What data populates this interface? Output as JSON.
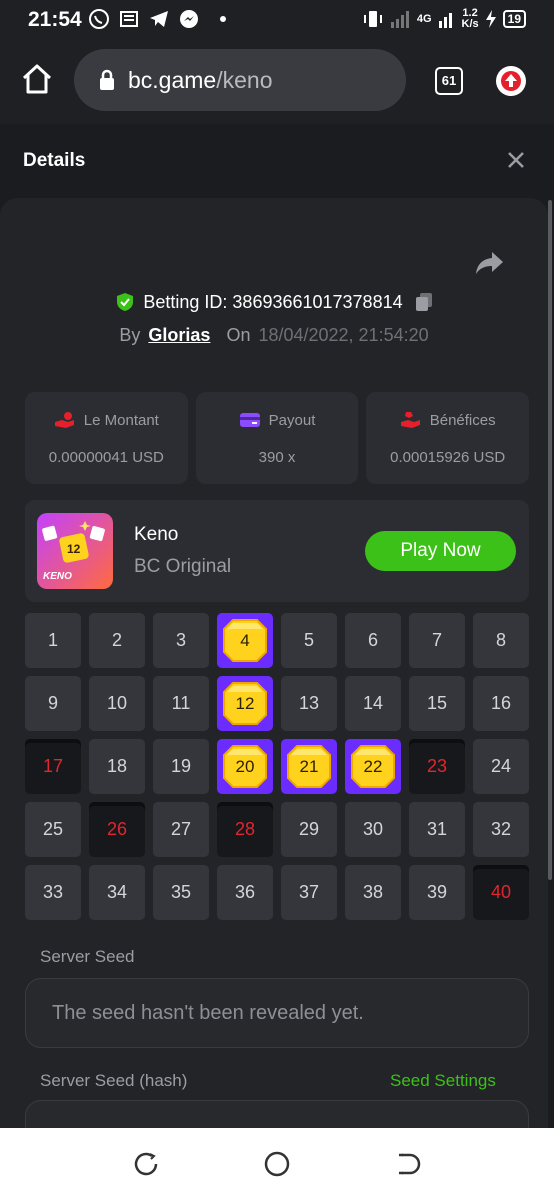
{
  "status": {
    "time": "21:54",
    "network": "4G",
    "speed": "1.2",
    "speed_unit": "K/s",
    "battery": "19"
  },
  "browser": {
    "url_host": "bc.game",
    "url_path": "/keno",
    "tab_count": "61"
  },
  "modal": {
    "title": "Details"
  },
  "bet": {
    "id_label": "Betting ID: 38693661017378814",
    "by_label": "By",
    "user": "Glorias",
    "on_label": "On",
    "datetime": "18/04/2022, 21:54:20"
  },
  "stats": [
    {
      "label": "Le Montant",
      "value": "0.00000041 USD",
      "icon": "coins-hand-icon"
    },
    {
      "label": "Payout",
      "value": "390 x",
      "icon": "card-icon"
    },
    {
      "label": "Bénéfices",
      "value": "0.00015926 USD",
      "icon": "profit-hand-icon"
    }
  ],
  "game": {
    "name": "Keno",
    "subtitle": "BC Original",
    "play_label": "Play Now",
    "thumb_text": "KENO",
    "thumb_die": "12"
  },
  "grid": {
    "cells": [
      "1",
      "2",
      "3",
      "4",
      "5",
      "6",
      "7",
      "8",
      "9",
      "10",
      "11",
      "12",
      "13",
      "14",
      "15",
      "16",
      "17",
      "18",
      "19",
      "20",
      "21",
      "22",
      "23",
      "24",
      "25",
      "26",
      "27",
      "28",
      "29",
      "30",
      "31",
      "32",
      "33",
      "34",
      "35",
      "36",
      "37",
      "38",
      "39",
      "40"
    ],
    "hits": [
      "4",
      "12",
      "20",
      "21",
      "22"
    ],
    "misses": [
      "17",
      "23",
      "26",
      "28",
      "40"
    ]
  },
  "seeds": {
    "server_seed_label": "Server Seed",
    "server_seed_value": "The seed hasn't been revealed yet.",
    "hash_label": "Server Seed (hash)",
    "settings_link": "Seed Settings"
  },
  "colors": {
    "accent_green": "#3bc117",
    "hit_purple": "#6a2cff",
    "miss_red": "#e0262f",
    "panel": "#232428"
  }
}
